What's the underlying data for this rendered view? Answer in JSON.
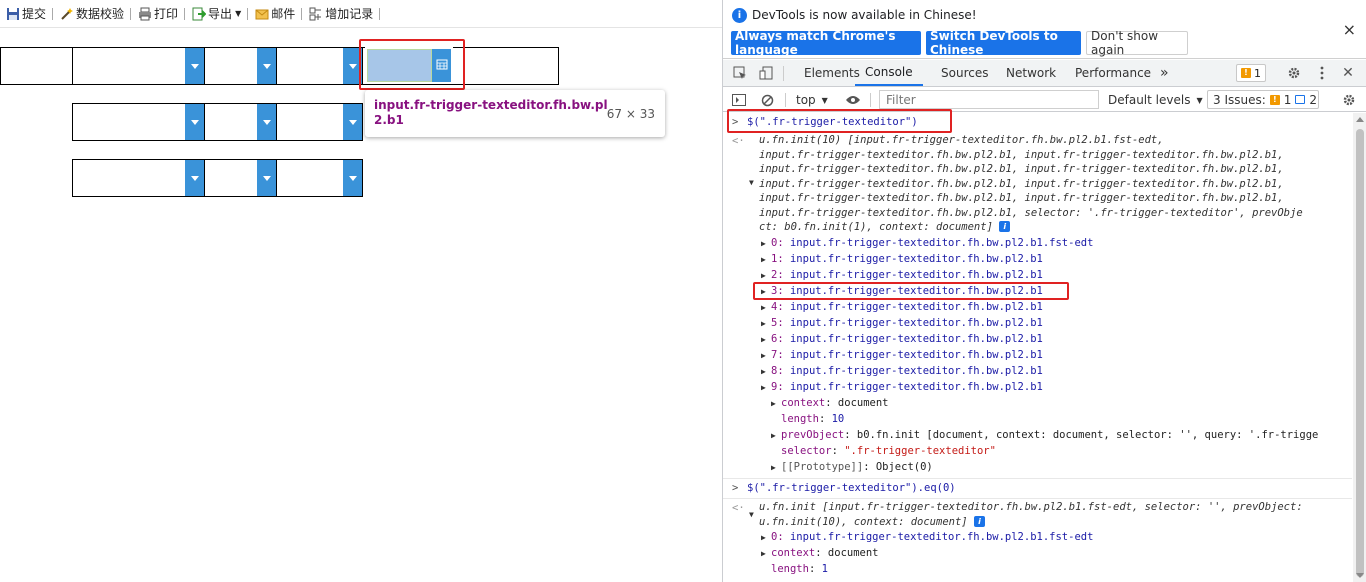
{
  "left": {
    "toolbar": [
      {
        "label": "提交",
        "icon": "save-icon"
      },
      {
        "label": "数据校验",
        "icon": "magic-wand-icon"
      },
      {
        "label": "打印",
        "icon": "printer-icon"
      },
      {
        "label": "导出",
        "icon": "export-icon",
        "has_caret": true
      },
      {
        "label": "邮件",
        "icon": "mail-icon"
      },
      {
        "label": "增加记录",
        "icon": "add-record-icon"
      }
    ],
    "tooltip": {
      "selector": "input.fr-trigger-texteditor.fh.bw.pl2.b1",
      "size": "67 × 33"
    }
  },
  "devtools": {
    "infobar": {
      "text": "DevTools is now available in Chinese!",
      "btn_match": "Always match Chrome's language",
      "btn_switch": "Switch DevTools to Chinese",
      "btn_dont": "Don't show again",
      "close": "×"
    },
    "tabs": [
      "Elements",
      "Console",
      "Sources",
      "Network",
      "Performance"
    ],
    "more_tabs": "»",
    "issues_badge_count": "1",
    "console_toolbar": {
      "context": "top",
      "filter_placeholder": "Filter",
      "levels": "Default levels",
      "issues_label": "3 Issues:",
      "issues_warn": "1",
      "issues_info": "2"
    },
    "console": {
      "cmd1": "$(\".fr-trigger-texteditor\")",
      "result1_lines": [
        "u.fn.init(10) [input.fr-trigger-texteditor.fh.bw.pl2.b1.fst-edt,",
        "input.fr-trigger-texteditor.fh.bw.pl2.b1, input.fr-trigger-texteditor.fh.bw.pl2.b1,",
        "input.fr-trigger-texteditor.fh.bw.pl2.b1, input.fr-trigger-texteditor.fh.bw.pl2.b1,",
        "input.fr-trigger-texteditor.fh.bw.pl2.b1, input.fr-trigger-texteditor.fh.bw.pl2.b1,",
        "input.fr-trigger-texteditor.fh.bw.pl2.b1, input.fr-trigger-texteditor.fh.bw.pl2.b1,",
        "input.fr-trigger-texteditor.fh.bw.pl2.b1, selector: '.fr-trigger-texteditor', prevObje",
        "ct: b0.fn.init(1), context: document]"
      ],
      "items": [
        {
          "key": "0",
          "val": "input.fr-trigger-texteditor.fh.bw.pl2.b1.fst-edt"
        },
        {
          "key": "1",
          "val": "input.fr-trigger-texteditor.fh.bw.pl2.b1"
        },
        {
          "key": "2",
          "val": "input.fr-trigger-texteditor.fh.bw.pl2.b1"
        },
        {
          "key": "3",
          "val": "input.fr-trigger-texteditor.fh.bw.pl2.b1"
        },
        {
          "key": "4",
          "val": "input.fr-trigger-texteditor.fh.bw.pl2.b1"
        },
        {
          "key": "5",
          "val": "input.fr-trigger-texteditor.fh.bw.pl2.b1"
        },
        {
          "key": "6",
          "val": "input.fr-trigger-texteditor.fh.bw.pl2.b1"
        },
        {
          "key": "7",
          "val": "input.fr-trigger-texteditor.fh.bw.pl2.b1"
        },
        {
          "key": "8",
          "val": "input.fr-trigger-texteditor.fh.bw.pl2.b1"
        },
        {
          "key": "9",
          "val": "input.fr-trigger-texteditor.fh.bw.pl2.b1"
        }
      ],
      "props1": {
        "context_key": "context",
        "context_val": "document",
        "length_key": "length",
        "length_val": "10",
        "prev_key": "prevObject",
        "prev_val": "b0.fn.init [document, context: document, selector: '', query: '.fr-trigge",
        "selector_key": "selector",
        "selector_val": "\".fr-trigger-texteditor\"",
        "proto_key": "[[Prototype]]",
        "proto_val": "Object(0)"
      },
      "cmd2": "$(\".fr-trigger-texteditor\").eq(0)",
      "result2_lines": [
        "u.fn.init [input.fr-trigger-texteditor.fh.bw.pl2.b1.fst-edt, selector: '', prevObject:",
        "u.fn.init(10), context: document]"
      ],
      "items2": [
        {
          "key": "0",
          "val": "input.fr-trigger-texteditor.fh.bw.pl2.b1.fst-edt"
        }
      ],
      "props2": {
        "context_key": "context",
        "context_val": "document",
        "length_key": "length",
        "length_val": "1"
      }
    }
  }
}
